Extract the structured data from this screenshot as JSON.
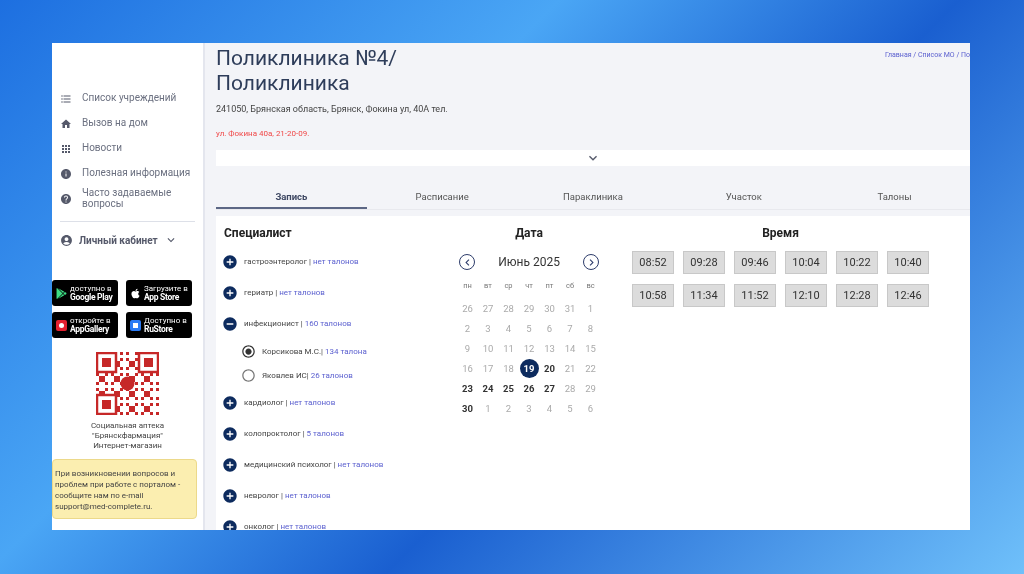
{
  "sidebar": {
    "items": [
      {
        "label": "Список учреждений"
      },
      {
        "label": "Вызов на дом"
      },
      {
        "label": "Новости"
      },
      {
        "label": "Полезная информация"
      },
      {
        "label": "Часто задаваемые вопросы"
      }
    ],
    "account": {
      "label": "Личный кабинет",
      "expanded": false
    },
    "stores": [
      {
        "kind": "google",
        "small": "доступно в",
        "name": "Google Play"
      },
      {
        "kind": "apple",
        "small": "Загрузите в",
        "name": "App Store"
      },
      {
        "kind": "huawei",
        "small": "откройте в",
        "name": "AppGallery"
      },
      {
        "kind": "rustore",
        "small": "Доступно в",
        "name": "RuStore"
      }
    ],
    "qr_caption": [
      "Социальная аптека",
      "\"Брянскфармация\"",
      "Интернет-магазин"
    ],
    "notice": "При возникновении вопросов и проблем при работе с порталом - сообщите нам по e-mail support@med-complete.ru."
  },
  "header": {
    "title": "Поликлиника №4/ Поликлиника",
    "address": "241050, Брянская область, Брянск, Фокина ул, 40А тел.",
    "note": "ул. Фокина 40а, 21-20-09.",
    "breadcrumbs": "Главная / Список МО / По",
    "details_expanded": false
  },
  "tabs": [
    {
      "label": "Запись",
      "selected": true
    },
    {
      "label": "Расписание",
      "selected": false
    },
    {
      "label": "Параклиника",
      "selected": false
    },
    {
      "label": "Участок",
      "selected": false
    },
    {
      "label": "Талоны",
      "selected": false
    }
  ],
  "specialists": {
    "title": "Специалист",
    "items": [
      {
        "name": "гастроэнтеролог | ",
        "tickets": "нет талонов",
        "expanded": false
      },
      {
        "name": "гериатр | ",
        "tickets": "нет талонов",
        "expanded": false
      },
      {
        "name": "инфекционист | ",
        "tickets": "160 талонов",
        "expanded": true,
        "children": [
          {
            "name": "Корсикова М.С.| ",
            "tickets": "134 талона",
            "selected": true
          },
          {
            "name": "Яковлев ИС| ",
            "tickets": "26 талонов",
            "selected": false
          }
        ]
      },
      {
        "name": "кардиолог | ",
        "tickets": "нет талонов",
        "expanded": false
      },
      {
        "name": "колопроктолог | ",
        "tickets": "5 талонов",
        "expanded": false
      },
      {
        "name": "медицинский психолог | ",
        "tickets": "нет талонов",
        "expanded": false
      },
      {
        "name": "невролог | ",
        "tickets": "нет талонов",
        "expanded": false
      },
      {
        "name": "онколог | ",
        "tickets": "нет талонов",
        "expanded": false
      }
    ]
  },
  "calendar": {
    "title": "Дата",
    "month": "Июнь 2025",
    "weekdays": [
      "пн",
      "вт",
      "ср",
      "чт",
      "пт",
      "сб",
      "вс"
    ],
    "weeks": [
      [
        {
          "day": "26",
          "kind": "muted"
        },
        {
          "day": "27",
          "kind": "muted"
        },
        {
          "day": "28",
          "kind": "muted"
        },
        {
          "day": "29",
          "kind": "muted"
        },
        {
          "day": "30",
          "kind": "muted"
        },
        {
          "day": "31",
          "kind": "muted"
        },
        {
          "day": "1",
          "kind": "muted"
        }
      ],
      [
        {
          "day": "2",
          "kind": "muted"
        },
        {
          "day": "3",
          "kind": "muted"
        },
        {
          "day": "4",
          "kind": "muted"
        },
        {
          "day": "5",
          "kind": "muted"
        },
        {
          "day": "6",
          "kind": "muted"
        },
        {
          "day": "7",
          "kind": "muted"
        },
        {
          "day": "8",
          "kind": "muted"
        }
      ],
      [
        {
          "day": "9",
          "kind": "muted"
        },
        {
          "day": "10",
          "kind": "muted"
        },
        {
          "day": "11",
          "kind": "muted"
        },
        {
          "day": "12",
          "kind": "muted"
        },
        {
          "day": "13",
          "kind": "muted"
        },
        {
          "day": "14",
          "kind": "muted"
        },
        {
          "day": "15",
          "kind": "muted"
        }
      ],
      [
        {
          "day": "16",
          "kind": "muted"
        },
        {
          "day": "17",
          "kind": "muted"
        },
        {
          "day": "18",
          "kind": "muted"
        },
        {
          "day": "19",
          "kind": "selected"
        },
        {
          "day": "20",
          "kind": "available"
        },
        {
          "day": "21",
          "kind": "muted"
        },
        {
          "day": "22",
          "kind": "muted"
        }
      ],
      [
        {
          "day": "23",
          "kind": "available"
        },
        {
          "day": "24",
          "kind": "available"
        },
        {
          "day": "25",
          "kind": "available"
        },
        {
          "day": "26",
          "kind": "available"
        },
        {
          "day": "27",
          "kind": "available"
        },
        {
          "day": "28",
          "kind": "muted"
        },
        {
          "day": "29",
          "kind": "muted"
        }
      ],
      [
        {
          "day": "30",
          "kind": "available"
        },
        {
          "day": "1",
          "kind": "muted"
        },
        {
          "day": "2",
          "kind": "muted"
        },
        {
          "day": "3",
          "kind": "muted"
        },
        {
          "day": "4",
          "kind": "muted"
        },
        {
          "day": "5",
          "kind": "muted"
        },
        {
          "day": "6",
          "kind": "muted"
        }
      ]
    ]
  },
  "times": {
    "title": "Время",
    "slots": [
      "08:52",
      "09:28",
      "09:46",
      "10:04",
      "10:22",
      "10:40",
      "10:58",
      "11:34",
      "11:52",
      "12:10",
      "12:28",
      "12:46"
    ]
  }
}
